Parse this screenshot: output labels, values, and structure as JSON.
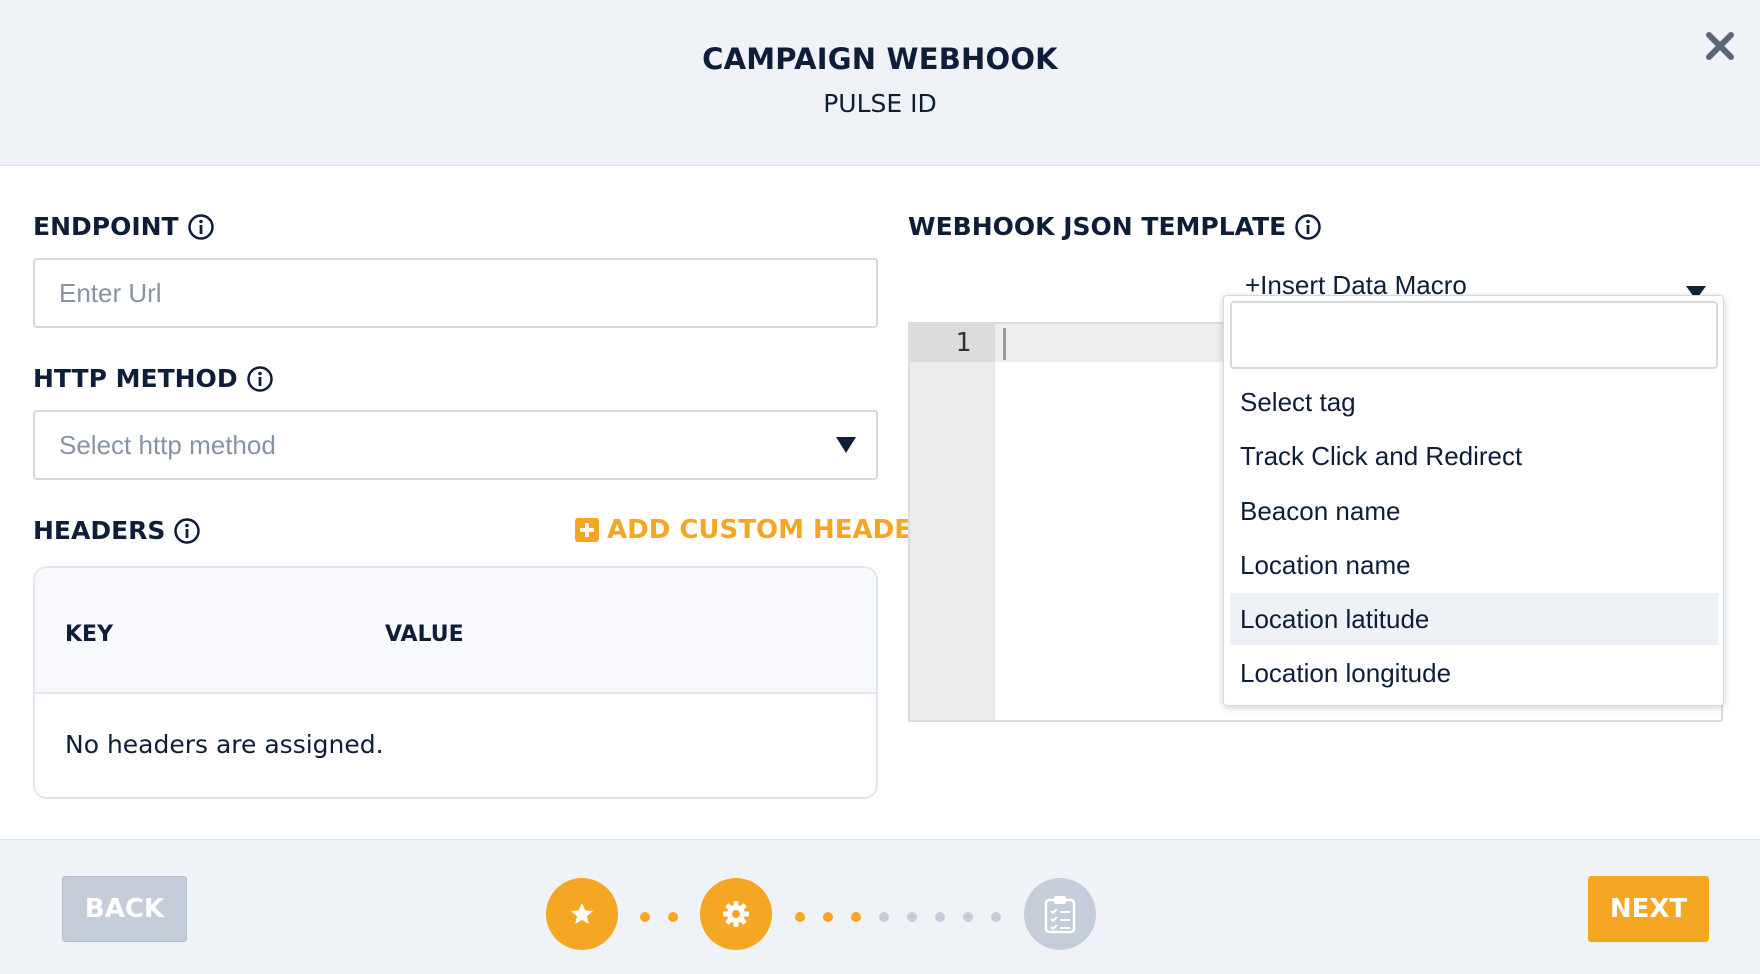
{
  "header": {
    "title": "CAMPAIGN WEBHOOK",
    "subtitle": "PULSE ID"
  },
  "form": {
    "endpoint": {
      "label": "ENDPOINT",
      "placeholder": "Enter Url"
    },
    "http_method": {
      "label": "HTTP METHOD",
      "placeholder": "Select http method"
    },
    "headers": {
      "label": "HEADERS",
      "add_label": "ADD CUSTOM HEADER",
      "columns": [
        "KEY",
        "VALUE"
      ],
      "empty_text": "No headers are assigned."
    }
  },
  "template": {
    "label": "WEBHOOK JSON TEMPLATE",
    "macro_select_label": "+Insert Data Macro",
    "line_number": "1",
    "dropdown": {
      "search_value": "",
      "options": [
        "Select tag",
        "Track Click and Redirect",
        "Beacon name",
        "Location name",
        "Location latitude",
        "Location longitude"
      ],
      "highlighted": "Location latitude"
    }
  },
  "footer": {
    "back_label": "BACK",
    "next_label": "NEXT",
    "steps": [
      {
        "icon": "star-icon",
        "state": "active"
      },
      {
        "icon": "gear-icon",
        "state": "active"
      },
      {
        "icon": "clipboard-icon",
        "state": "inactive"
      }
    ]
  },
  "colors": {
    "accent": "#f5a623",
    "text": "#0e1e38",
    "muted": "#c4cdd9",
    "header_bg": "#eff2f7"
  }
}
